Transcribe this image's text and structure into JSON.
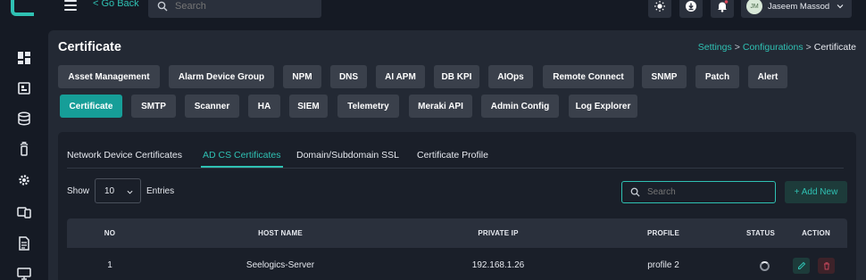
{
  "topbar": {
    "go_back": "< Go Back",
    "search_placeholder": "Search",
    "user_initials": "JM",
    "user_name": "Jaseem Massod"
  },
  "sidebar": {
    "icons": [
      "dashboard-icon",
      "assets-icon",
      "database-icon",
      "remote-icon",
      "settings-gear-icon",
      "devices-icon",
      "document-icon",
      "monitor-icon"
    ]
  },
  "page": {
    "title": "Certificate",
    "breadcrumb": {
      "settings": "Settings",
      "configurations": "Configurations",
      "current": "Certificate"
    }
  },
  "modules": {
    "row1": [
      "Asset Management",
      "Alarm Device Group",
      "NPM",
      "DNS",
      "AI APM",
      "DB KPI",
      "AIOps",
      "Remote Connect",
      "SNMP",
      "Patch",
      "Alert"
    ],
    "row2": [
      "Certificate",
      "SMTP",
      "Scanner",
      "HA",
      "SIEM",
      "Telemetry",
      "Meraki API",
      "Admin Config",
      "Log Explorer"
    ],
    "active": "Certificate"
  },
  "subtabs": {
    "items": [
      "Network Device Certificates",
      "AD CS Certificates",
      "Domain/Subdomain SSL",
      "Certificate Profile"
    ],
    "active": "AD CS Certificates"
  },
  "controls": {
    "show_label": "Show",
    "entries_value": "10",
    "entries_label": "Entries",
    "search_placeholder": "Search",
    "add_new": "+ Add New"
  },
  "table": {
    "columns": [
      "NO",
      "HOST NAME",
      "PRIVATE IP",
      "PROFILE",
      "STATUS",
      "ACTION"
    ],
    "rows": [
      {
        "no": "1",
        "host_name": "Seelogics-Server",
        "private_ip": "192.168.1.26",
        "profile": "profile 2"
      }
    ]
  },
  "colors": {
    "accent": "#2fc1b3",
    "active_button": "#169e98",
    "background": "#151a24",
    "panel": "#232934",
    "delete": "#c2465a"
  }
}
